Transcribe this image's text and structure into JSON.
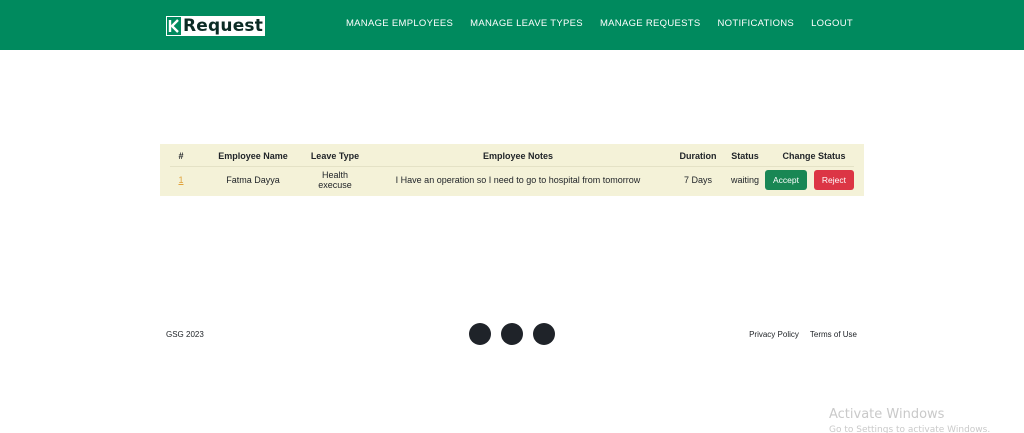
{
  "brand": {
    "name": "Request",
    "logo_icon": "k-arrow-logo-icon",
    "color": "#008a5e"
  },
  "nav": {
    "items": [
      {
        "label": "MANAGE EMPLOYEES"
      },
      {
        "label": "MANAGE LEAVE TYPES"
      },
      {
        "label": "MANAGE REQUESTS"
      },
      {
        "label": "NOTIFICATIONS"
      },
      {
        "label": "LOGOUT"
      }
    ]
  },
  "table": {
    "headers": [
      "#",
      "Employee Name",
      "Leave Type",
      "Employee Notes",
      "Duration",
      "Status",
      "Change Status"
    ],
    "rows": [
      {
        "index": "1",
        "employee_name": "Fatma Dayya",
        "leave_type": "Health execuse",
        "notes": "I Have an operation so I need to go to hospital from tomorrow",
        "duration": "7 Days",
        "status": "waiting",
        "accept_label": "Accept",
        "reject_label": "Reject"
      }
    ]
  },
  "footer": {
    "copyright": "GSG 2023",
    "links": [
      {
        "label": "Privacy Policy"
      },
      {
        "label": "Terms of Use"
      }
    ],
    "social_icons": [
      "social-icon",
      "social-icon",
      "social-icon"
    ]
  },
  "watermark": {
    "line1": "Activate Windows",
    "line2": "Go to Settings to activate Windows."
  },
  "colors": {
    "accept": "#198754",
    "reject": "#dc3545",
    "table_bg": "#f4f2d8"
  }
}
